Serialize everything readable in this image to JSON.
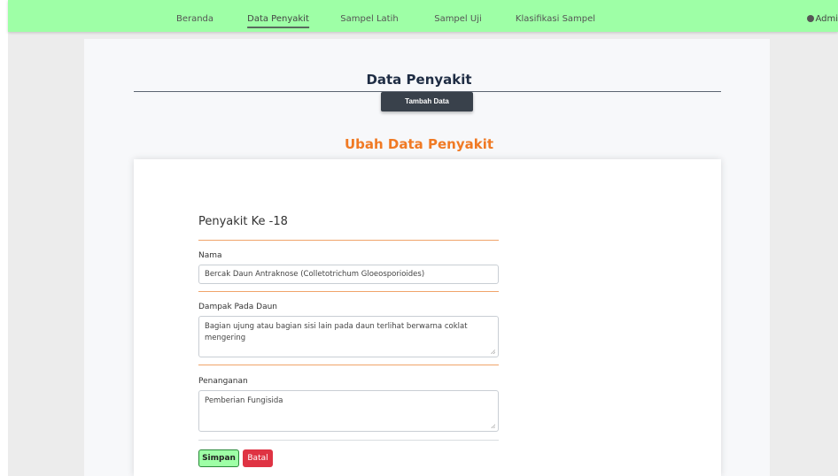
{
  "nav": {
    "items": [
      {
        "label": "Beranda"
      },
      {
        "label": "Data Penyakit"
      },
      {
        "label": "Sampel Latih"
      },
      {
        "label": "Sampel Uji"
      },
      {
        "label": "Klasifikasi Sampel"
      }
    ],
    "active": "Data Penyakit",
    "user_label": "Admi",
    "user_icon": "user-circle-icon"
  },
  "page": {
    "title": "Data Penyakit",
    "add_button": "Tambah Data"
  },
  "form": {
    "heading": "Ubah Data Penyakit",
    "disease_title": "Penyakit Ke -18",
    "name_label": "Nama",
    "name_value": "Bercak Daun Antraknose (Colletotrichum Gloeosporioides)",
    "impact_label": "Dampak Pada Daun",
    "impact_value": "Bagian ujung atau bagian sisi lain pada daun terlihat berwarna coklat mengering",
    "treatment_label": "Penanganan",
    "treatment_value": "Pemberian Fungisida",
    "save_button": "Simpan",
    "cancel_button": "Batal"
  },
  "colors": {
    "navbar": "#9effa6",
    "accent": "#f07a24",
    "dark_button": "#39414b",
    "save_button": "#9effa6",
    "cancel_button": "#df3343"
  }
}
